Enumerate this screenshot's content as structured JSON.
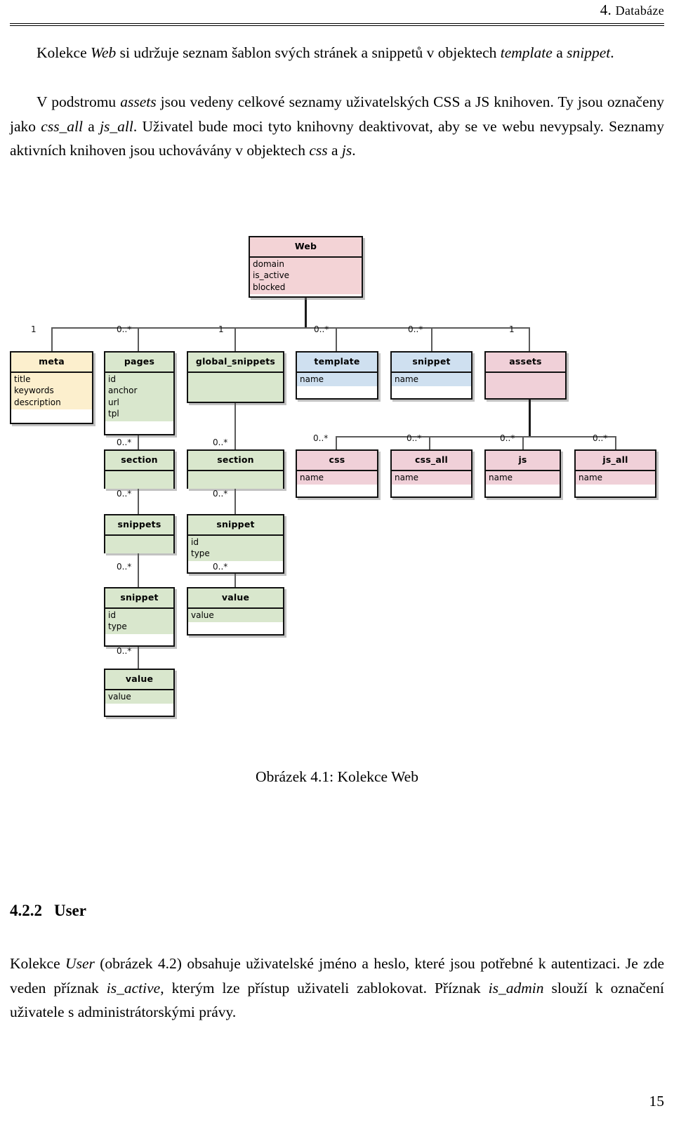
{
  "header": {
    "chapter_number": "4.",
    "chapter_name": "Databáze"
  },
  "paragraphs": {
    "p1_a": "Kolekce ",
    "p1_web": "Web",
    "p1_b": " si udržuje seznam šablon svých stránek a snippetů v objektech ",
    "p1_template": "template",
    "p1_c": " a ",
    "p1_snippet": "snippet",
    "p1_d": ".",
    "p2_a": "V podstromu ",
    "p2_assets": "assets",
    "p2_b": " jsou vedeny celkové seznamy uživatelských CSS a JS knihoven. Ty jsou označeny jako ",
    "p2_cssall": "css_all",
    "p2_c": " a ",
    "p2_jsall": "js_all",
    "p2_d": ". Uživatel bude moci tyto knihovny deaktivovat, aby se ve webu nevypsaly. Seznamy aktivních knihoven jsou uchovávány v objektech ",
    "p2_css": "css",
    "p2_e": " a ",
    "p2_js": "js",
    "p2_f": "."
  },
  "figure": {
    "caption": "Obrázek 4.1: Kolekce Web",
    "colors": {
      "pink": "#f3d3d6",
      "pink_light": "#f0d0d8",
      "green": "#d9e7cd",
      "blue": "#cfe0f0",
      "cream": "#fcefcd",
      "border": "#111111",
      "edge": "#5a5a5a"
    },
    "nodes": {
      "web": {
        "title": "Web",
        "attrs": [
          "domain",
          "is_active",
          "blocked"
        ]
      },
      "meta": {
        "title": "meta",
        "attrs": [
          "title",
          "keywords",
          "description"
        ]
      },
      "pages": {
        "title": "pages",
        "attrs": [
          "id",
          "anchor",
          "url",
          "tpl"
        ]
      },
      "global_snippets": {
        "title": "global_snippets",
        "attrs": []
      },
      "template": {
        "title": "template",
        "attrs": [
          "name"
        ]
      },
      "snippet_top": {
        "title": "snippet",
        "attrs": [
          "name"
        ]
      },
      "assets": {
        "title": "assets",
        "attrs": []
      },
      "section_a": {
        "title": "section",
        "attrs": []
      },
      "section_b": {
        "title": "section",
        "attrs": []
      },
      "css": {
        "title": "css",
        "attrs": [
          "name"
        ]
      },
      "css_all": {
        "title": "css_all",
        "attrs": [
          "name"
        ]
      },
      "js": {
        "title": "js",
        "attrs": [
          "name"
        ]
      },
      "js_all": {
        "title": "js_all",
        "attrs": [
          "name"
        ]
      },
      "snippets": {
        "title": "snippets",
        "attrs": []
      },
      "snippet_b": {
        "title": "snippet",
        "attrs": [
          "id",
          "type"
        ]
      },
      "snippet_a": {
        "title": "snippet",
        "attrs": [
          "id",
          "type"
        ]
      },
      "value_b": {
        "title": "value",
        "attrs": [
          "value"
        ]
      },
      "value_a": {
        "title": "value",
        "attrs": [
          "value"
        ]
      }
    },
    "cardinalities": {
      "meta": "1",
      "pages": "0..*",
      "global_snippets": "1",
      "template": "0..*",
      "snippet_top": "0..*",
      "assets": "1",
      "section_a": "0..*",
      "section_b": "0..*",
      "css": "0..*",
      "css_all": "0..*",
      "js": "0..*",
      "js_all": "0..*",
      "snippets": "0..*",
      "snippet_b": "0..*",
      "snippet_a": "0..*",
      "value_b": "0..*",
      "value_a": "0..*"
    }
  },
  "section": {
    "number": "4.2.2",
    "title": "User",
    "p_a": "Kolekce ",
    "p_user": "User",
    "p_b": " (obrázek 4.2) obsahuje uživatelské jméno a heslo, které jsou potřebné k autentizaci. Je zde veden příznak ",
    "p_isactive": "is_active",
    "p_c": ", kterým lze přístup uživateli zablokovat. Příznak ",
    "p_isadmin": "is_admin",
    "p_d": " slouží k označení uživatele s administrátorskými právy."
  },
  "page_number": "15"
}
